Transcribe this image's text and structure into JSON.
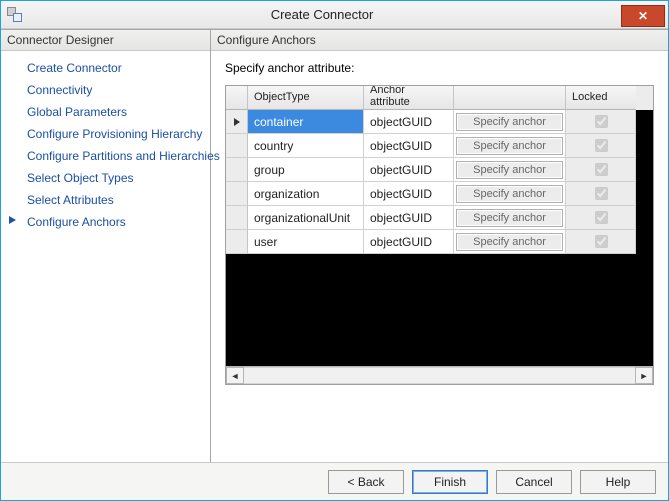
{
  "window": {
    "title": "Create Connector"
  },
  "left": {
    "heading": "Connector Designer",
    "items": [
      "Create Connector",
      "Connectivity",
      "Global Parameters",
      "Configure Provisioning Hierarchy",
      "Configure Partitions and Hierarchies",
      "Select Object Types",
      "Select Attributes",
      "Configure Anchors"
    ],
    "active_index": 7
  },
  "right": {
    "heading": "Configure Anchors",
    "instruction": "Specify anchor attribute:",
    "columns": {
      "col0": "",
      "col1": "ObjectType",
      "col2_line1": "Anchor",
      "col2_line2": "attribute",
      "col3": "",
      "col4": "Locked"
    },
    "specify_label": "Specify anchor",
    "rows": [
      {
        "object_type": "container",
        "anchor": "objectGUID",
        "locked": true,
        "selected": true
      },
      {
        "object_type": "country",
        "anchor": "objectGUID",
        "locked": true,
        "selected": false
      },
      {
        "object_type": "group",
        "anchor": "objectGUID",
        "locked": true,
        "selected": false
      },
      {
        "object_type": "organization",
        "anchor": "objectGUID",
        "locked": true,
        "selected": false
      },
      {
        "object_type": "organizationalUnit",
        "anchor": "objectGUID",
        "locked": true,
        "selected": false
      },
      {
        "object_type": "user",
        "anchor": "objectGUID",
        "locked": true,
        "selected": false
      }
    ]
  },
  "buttons": {
    "back": "<  Back",
    "finish": "Finish",
    "cancel": "Cancel",
    "help": "Help"
  }
}
